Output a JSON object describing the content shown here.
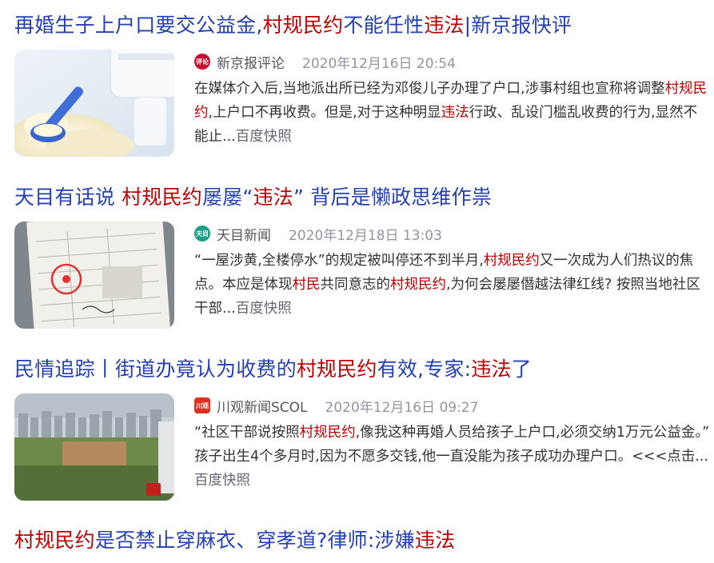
{
  "results": [
    {
      "title": [
        {
          "t": "再婚生子上户口要交公益金,"
        },
        {
          "t": "村规民约",
          "hl": true
        },
        {
          "t": "不能任性"
        },
        {
          "t": "违法",
          "hl": true
        },
        {
          "t": "|新京报快评"
        }
      ],
      "source": "新京报评论",
      "source_icon": "xinjingbao-logo-icon",
      "source_icon_text": "评论",
      "time": "2020年12月16日 20:54",
      "snippet": [
        {
          "t": "在媒体介入后,当地派出所已经为邓俊儿子办理了户口,涉事村组也宣称将调整"
        },
        {
          "t": "村规民约",
          "hl": true
        },
        {
          "t": ",上户口不再收费。但是,对于这种明显"
        },
        {
          "t": "违法",
          "hl": true
        },
        {
          "t": "行政、乱设门槛乱收费的行为,显然不能止..."
        }
      ],
      "cache_link": "百度快照",
      "thumb_desc": "milk-powder-scoop-image"
    },
    {
      "title": [
        {
          "t": "天目有话说 "
        },
        {
          "t": "村规民约",
          "hl": true
        },
        {
          "t": "屡屡“"
        },
        {
          "t": "违法",
          "hl": true
        },
        {
          "t": "” 背后是懒政思维作祟"
        }
      ],
      "source": "天目新闻",
      "source_icon": "tianmu-logo-icon",
      "source_icon_text": "天目",
      "time": "2020年12月18日 13:03",
      "snippet": [
        {
          "t": "“一屋涉黄,全楼停水”的规定被叫停还不到半月,"
        },
        {
          "t": "村规民约",
          "hl": true
        },
        {
          "t": "又一次成为人们热议的焦点。本应是体现"
        },
        {
          "t": "村民",
          "hl": true
        },
        {
          "t": "共同意志的"
        },
        {
          "t": "村规民约",
          "hl": true
        },
        {
          "t": ",为何会屡屡僭越法律红线? 按照当地社区干部..."
        }
      ],
      "cache_link": "百度快照",
      "thumb_desc": "household-register-document-image"
    },
    {
      "title": [
        {
          "t": "民情追踪丨街道办竟认为收费的"
        },
        {
          "t": "村规民约",
          "hl": true
        },
        {
          "t": "有效,专家:"
        },
        {
          "t": "违法",
          "hl": true
        },
        {
          "t": "了"
        }
      ],
      "source": "川观新闻SCOL",
      "source_icon": "chuanguan-logo-icon",
      "source_icon_text": "川观",
      "time": "2020年12月16日 09:27",
      "snippet": [
        {
          "t": "“社区干部说按照"
        },
        {
          "t": "村规民约",
          "hl": true
        },
        {
          "t": ",像我这种再婚人员给孩子上户口,必须交纳1万元公益金。” 孩子出生4个多月时,因为不愿多交钱,他一直没能为孩子成功办理户口。<<<点击..."
        }
      ],
      "cache_link": "百度快照",
      "thumb_desc": "city-aerial-view-image"
    },
    {
      "title": [
        {
          "t": "村规民约",
          "hl": true
        },
        {
          "t": "是否禁止穿麻衣、穿孝道?律师:涉嫌"
        },
        {
          "t": "违法",
          "hl": true
        }
      ]
    }
  ],
  "colors": {
    "title": "#2440b3",
    "highlight": "#c00000",
    "meta": "#9195a3",
    "snippet": "#333333"
  }
}
